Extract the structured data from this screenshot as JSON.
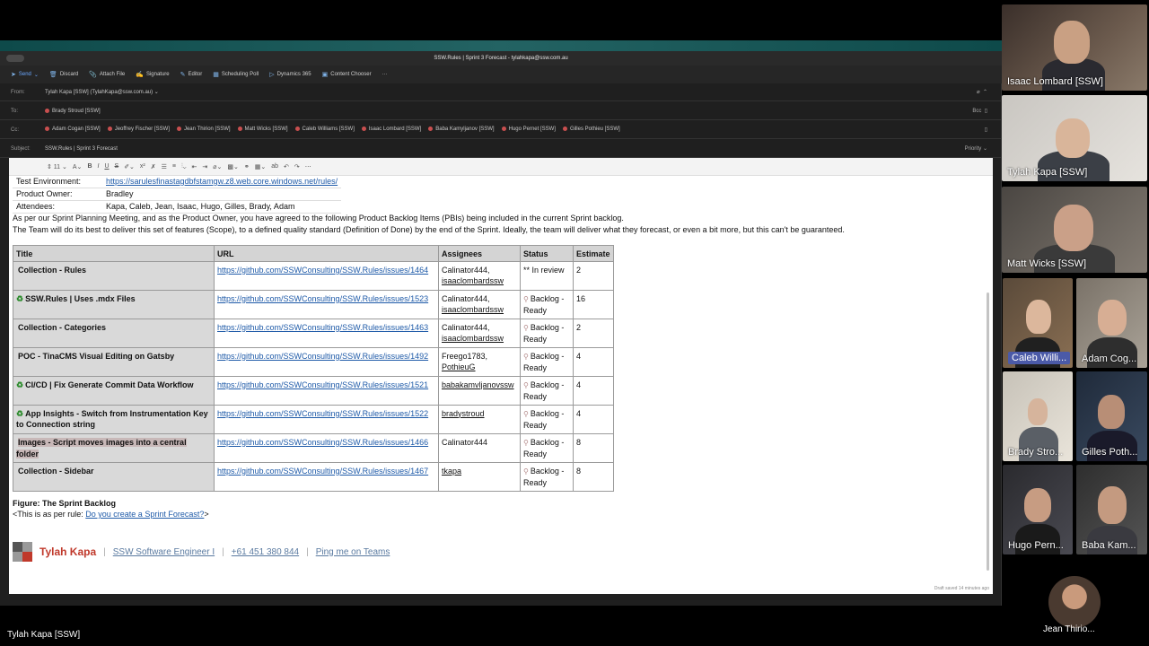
{
  "window_title": "SSW.Rules | Sprint 3 Forecast - tylahkapa@ssw.com.au",
  "toolbar": [
    {
      "icon": "send-icon",
      "label": "Send"
    },
    {
      "icon": "trash-icon",
      "label": "Discard"
    },
    {
      "icon": "paperclip-icon",
      "label": "Attach File"
    },
    {
      "icon": "signature-icon",
      "label": "Signature"
    },
    {
      "icon": "editor-icon",
      "label": "Editor"
    },
    {
      "icon": "scheduling-icon",
      "label": "Scheduling Poll"
    },
    {
      "icon": "dynamics-icon",
      "label": "Dynamics 365"
    },
    {
      "icon": "content-icon",
      "label": "Content Chooser"
    },
    {
      "icon": "more-icon",
      "label": "···"
    }
  ],
  "from": {
    "label": "From:",
    "value": "Tylah Kapa [SSW] (TylahKapa@ssw.com.au) ⌄"
  },
  "to": {
    "label": "To:",
    "recipients": [
      "Brady Stroud [SSW]"
    ],
    "bcc": "Bcc"
  },
  "cc": {
    "label": "Cc:",
    "recipients": [
      "Adam Cogan [SSW]",
      "Jeoffrey Fischer [SSW]",
      "Jean Thirion [SSW]",
      "Matt Wicks [SSW]",
      "Caleb Williams [SSW]",
      "Isaac Lombard [SSW]",
      "Baba Kamyljanov [SSW]",
      "Hugo Pernet [SSW]",
      "Gilles Pothieu [SSW]"
    ]
  },
  "subject": {
    "label": "Subject:",
    "value": "SSW.Rules | Sprint 3 Forecast",
    "priority": "Priority ⌄"
  },
  "meta": [
    {
      "key": "Test Environment:",
      "value": "https://sarulesfinastagdbfstamgw.z8.web.core.windows.net/rules/",
      "link": true
    },
    {
      "key": "Product Owner:",
      "value": "Bradley",
      "link": false
    },
    {
      "key": "Attendees:",
      "value": "Kapa, Caleb, Jean, Isaac, Hugo, Gilles, Brady, Adam",
      "link": false
    }
  ],
  "para1": "As per our Sprint Planning Meeting, and as the Product Owner, you have agreed to the following Product Backlog Items (PBIs) being included in the current Sprint backlog.",
  "para2": "The Team will do its best to deliver this set of features (Scope), to a defined quality standard (Definition of Done) by the end of the Sprint. Ideally, the team will deliver what they forecast, or even a bit more, but this can't be guaranteed.",
  "table": {
    "headers": [
      "Title",
      "URL",
      "Assignees",
      "Status",
      "Estimate"
    ],
    "rows": [
      {
        "icon": "",
        "title": "Collection - Rules",
        "url": "https://github.com/SSWConsulting/SSW.Rules/issues/1464",
        "a1": "Calinator444,",
        "a2": "isaaclombardssw",
        "status": "** In review",
        "estimate": "2"
      },
      {
        "icon": "♻",
        "title": "SSW.Rules | Uses .mdx Files",
        "url": "https://github.com/SSWConsulting/SSW.Rules/issues/1523",
        "a1": "Calinator444,",
        "a2": "isaaclombardssw",
        "status": "Backlog - Ready",
        "estimate": "16"
      },
      {
        "icon": "",
        "title": "Collection - Categories",
        "url": "https://github.com/SSWConsulting/SSW.Rules/issues/1463",
        "a1": "Calinator444,",
        "a2": "isaaclombardssw",
        "status": "Backlog - Ready",
        "estimate": "2"
      },
      {
        "icon": "",
        "title": "POC - TinaCMS Visual Editing on Gatsby",
        "url": "https://github.com/SSWConsulting/SSW.Rules/issues/1492",
        "a1": "Freego1783,",
        "a2": "PothieuG",
        "status": "Backlog - Ready",
        "estimate": "4"
      },
      {
        "icon": "♻",
        "title": "CI/CD | Fix Generate Commit Data Workflow",
        "url": "https://github.com/SSWConsulting/SSW.Rules/issues/1521",
        "a1": "",
        "a2": "babakamvljanovssw",
        "status": "Backlog - Ready",
        "estimate": "4"
      },
      {
        "icon": "♻",
        "title": "App Insights - Switch from Instrumentation Key to Connection string",
        "url": "https://github.com/SSWConsulting/SSW.Rules/issues/1522",
        "a1": "",
        "a2": "bradystroud",
        "status": "Backlog - Ready",
        "estimate": "4"
      },
      {
        "icon": "",
        "title": "Images - Script moves images into a central folder",
        "url": "https://github.com/SSWConsulting/SSW.Rules/issues/1466",
        "a1": "Calinator444",
        "a2": "",
        "status": "Backlog - Ready",
        "estimate": "8"
      },
      {
        "icon": "",
        "title": "Collection - Sidebar",
        "url": "https://github.com/SSWConsulting/SSW.Rules/issues/1467",
        "a1": "",
        "a2": "tkapa",
        "status": "Backlog - Ready",
        "estimate": "8"
      }
    ]
  },
  "figure_caption": "Figure: The Sprint Backlog",
  "rule_prefix": "<This is as per rule: ",
  "rule_link": "Do you create a Sprint Forecast?",
  "rule_suffix": ">",
  "signature": {
    "name": "Tylah Kapa",
    "title": "SSW Software Engineer I",
    "phone": "+61 451 380 844",
    "teams": "Ping me on Teams"
  },
  "draft_status": "Draft saved 14 minutes ago",
  "participants": [
    {
      "name": "Isaac Lombard [SSW]"
    },
    {
      "name": "Tylah Kapa [SSW]"
    },
    {
      "name": "Matt Wicks [SSW]"
    },
    {
      "name": "Caleb Willi..."
    },
    {
      "name": "Adam Cog..."
    },
    {
      "name": "Brady Stro..."
    },
    {
      "name": "Gilles Poth..."
    },
    {
      "name": "Hugo Pern..."
    },
    {
      "name": "Baba Kam..."
    },
    {
      "name": "Jean Thirio..."
    }
  ],
  "presenter": "Tylah Kapa [SSW]"
}
